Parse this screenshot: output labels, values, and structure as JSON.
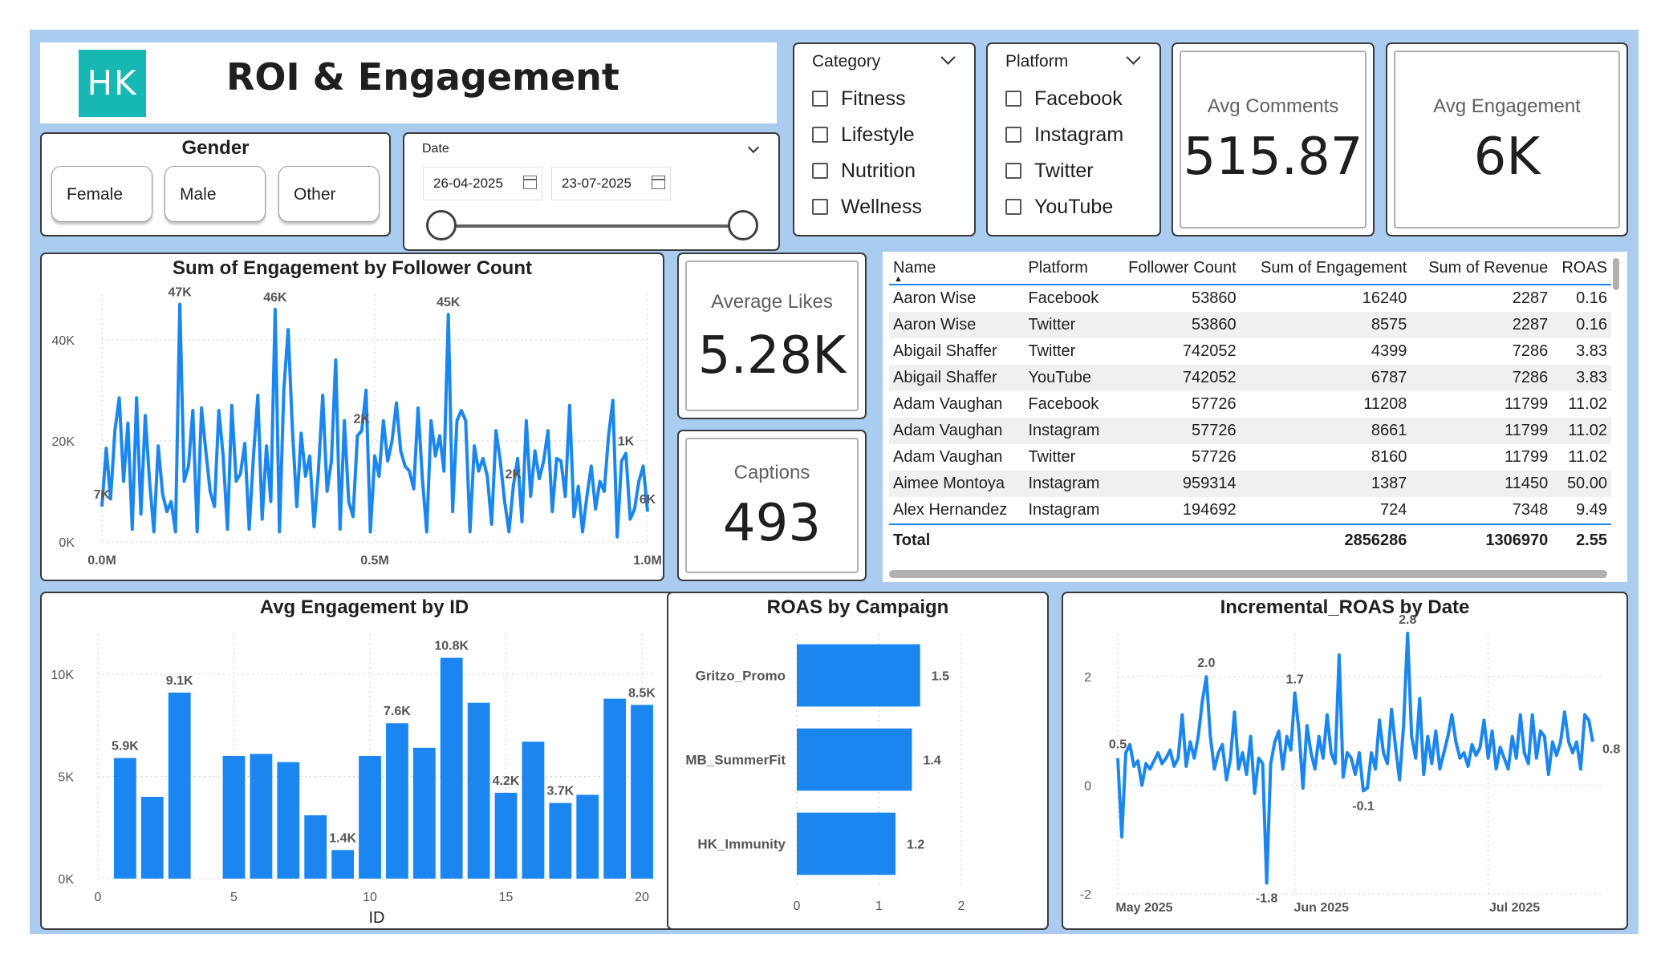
{
  "header": {
    "logo_text": "HK",
    "title": "ROI & Engagement"
  },
  "gender": {
    "title": "Gender",
    "buttons": [
      "Female",
      "Male",
      "Other"
    ]
  },
  "date_filter": {
    "label": "Date",
    "start": "26-04-2025",
    "end": "23-07-2025"
  },
  "category_filter": {
    "label": "Category",
    "options": [
      "Fitness",
      "Lifestyle",
      "Nutrition",
      "Wellness"
    ]
  },
  "platform_filter": {
    "label": "Platform",
    "options": [
      "Facebook",
      "Instagram",
      "Twitter",
      "YouTube"
    ]
  },
  "kpis": {
    "avg_comments": {
      "label": "Avg Comments",
      "value": "515.87"
    },
    "avg_engagement": {
      "label": "Avg Engagement",
      "value": "6K"
    },
    "average_likes": {
      "label": "Average Likes",
      "value": "5.28K"
    },
    "captions": {
      "label": "Captions",
      "value": "493"
    }
  },
  "table": {
    "columns": [
      "Name",
      "Platform",
      "Follower Count",
      "Sum of Engagement",
      "Sum of Revenue",
      "ROAS"
    ],
    "rows": [
      [
        "Aaron Wise",
        "Facebook",
        "53860",
        "16240",
        "2287",
        "0.16"
      ],
      [
        "Aaron Wise",
        "Twitter",
        "53860",
        "8575",
        "2287",
        "0.16"
      ],
      [
        "Abigail Shaffer",
        "Twitter",
        "742052",
        "4399",
        "7286",
        "3.83"
      ],
      [
        "Abigail Shaffer",
        "YouTube",
        "742052",
        "6787",
        "7286",
        "3.83"
      ],
      [
        "Adam Vaughan",
        "Facebook",
        "57726",
        "11208",
        "11799",
        "11.02"
      ],
      [
        "Adam Vaughan",
        "Instagram",
        "57726",
        "8661",
        "11799",
        "11.02"
      ],
      [
        "Adam Vaughan",
        "Twitter",
        "57726",
        "8160",
        "11799",
        "11.02"
      ],
      [
        "Aimee Montoya",
        "Instagram",
        "959314",
        "1387",
        "11450",
        "50.00"
      ],
      [
        "Alex Hernandez",
        "Instagram",
        "194692",
        "724",
        "7348",
        "9.49"
      ]
    ],
    "total": {
      "label": "Total",
      "sum_engagement": "2856286",
      "sum_revenue": "1306970",
      "roas": "2.55"
    }
  },
  "chart_data": [
    {
      "id": "engagement_by_follower",
      "type": "line",
      "title": "Sum of Engagement by Follower Count",
      "x_ticks": [
        "0.0M",
        "0.5M",
        "1.0M"
      ],
      "y_ticks": [
        "0K",
        "20K",
        "40K"
      ],
      "xlim": [
        0,
        1000000
      ],
      "ylim": [
        0,
        49000
      ],
      "color": "#1b86f0",
      "y": [
        7000,
        18500,
        8500,
        22000,
        28500,
        12000,
        23500,
        2500,
        28500,
        5500,
        25000,
        12000,
        2000,
        19000,
        9500,
        6000,
        8000,
        2000,
        47000,
        12000,
        15000,
        26000,
        2000,
        26500,
        18000,
        10000,
        7000,
        26000,
        17000,
        2500,
        27000,
        12000,
        13500,
        19500,
        2500,
        17000,
        29000,
        4500,
        19000,
        8000,
        46000,
        2000,
        30000,
        42000,
        22000,
        7000,
        21500,
        13000,
        17000,
        3000,
        14000,
        29000,
        10000,
        16000,
        36000,
        2500,
        24000,
        8000,
        5000,
        21000,
        22000,
        30000,
        2000,
        17000,
        13000,
        24000,
        16000,
        20000,
        27500,
        18000,
        15000,
        14000,
        10500,
        26500,
        12500,
        2000,
        24000,
        17000,
        21000,
        14000,
        45000,
        6000,
        24000,
        26000,
        24000,
        2000,
        19000,
        14000,
        16500,
        13000,
        3500,
        22000,
        16000,
        8000,
        2000,
        11000,
        16500,
        4000,
        24000,
        9000,
        18000,
        12500,
        16000,
        22000,
        6000,
        16500,
        16000,
        9000,
        27000,
        5000,
        11000,
        2000,
        9000,
        15000,
        6500,
        12000,
        10000,
        21000,
        28000,
        1000,
        16000,
        17500,
        4500,
        6500,
        12000,
        15000,
        6000
      ],
      "labels": [
        {
          "i": 0,
          "text": "7K"
        },
        {
          "i": 18,
          "text": "47K"
        },
        {
          "i": 40,
          "text": "46K"
        },
        {
          "i": 60,
          "text": "2K"
        },
        {
          "i": 80,
          "text": "45K"
        },
        {
          "i": 95,
          "text": "2K"
        },
        {
          "i": 121,
          "text": "1K"
        },
        {
          "i": 126,
          "text": "6K"
        }
      ]
    },
    {
      "id": "avg_engagement_by_id",
      "type": "bar",
      "title": "Avg Engagement by ID",
      "xlabel": "ID",
      "x_ticks": [
        "0",
        "5",
        "10",
        "15",
        "20"
      ],
      "y_ticks": [
        "0K",
        "5K",
        "10K"
      ],
      "xlim": [
        0,
        20.5
      ],
      "ylim": [
        0,
        12000
      ],
      "color": "#1b86f0",
      "categories": [
        1,
        2,
        3,
        4,
        5,
        6,
        7,
        8,
        9,
        10,
        11,
        12,
        13,
        14,
        15,
        16,
        17,
        18,
        19,
        20
      ],
      "values": [
        5900,
        4000,
        9100,
        6000,
        6100,
        5700,
        3100,
        1400,
        6000,
        7600,
        6400,
        10800,
        8600,
        4200,
        6700,
        3700,
        4100,
        8800,
        8500
      ],
      "ids": [
        1,
        2,
        3,
        5,
        6,
        7,
        8,
        9,
        10,
        11,
        12,
        13,
        14,
        15,
        16,
        17,
        18,
        19,
        20
      ],
      "labels": [
        {
          "id": 1,
          "text": "5.9K"
        },
        {
          "id": 3,
          "text": "9.1K"
        },
        {
          "id": 9,
          "text": "1.4K"
        },
        {
          "id": 11,
          "text": "7.6K"
        },
        {
          "id": 13,
          "text": "10.8K"
        },
        {
          "id": 15,
          "text": "4.2K"
        },
        {
          "id": 17,
          "text": "3.7K"
        },
        {
          "id": 20,
          "text": "8.5K"
        }
      ]
    },
    {
      "id": "roas_by_campaign",
      "type": "bar",
      "orientation": "horizontal",
      "title": "ROAS by Campaign",
      "categories": [
        "Gritzo_Promo",
        "MB_SummerFit",
        "HK_Immunity"
      ],
      "values": [
        1.5,
        1.4,
        1.2
      ],
      "value_labels": [
        "1.5",
        "1.4",
        "1.2"
      ],
      "x_ticks": [
        "0",
        "1",
        "2"
      ],
      "xlim": [
        0,
        2
      ],
      "color": "#1b86f0"
    },
    {
      "id": "incremental_roas_by_date",
      "type": "line",
      "title": "Incremental_ROAS by Date",
      "x_ticks": [
        "May 2025",
        "Jun 2025",
        "Jul 2025"
      ],
      "y_ticks": [
        "-2",
        "0",
        "2"
      ],
      "ylim": [
        -2,
        2.8
      ],
      "color": "#1b86f0",
      "y": [
        0.5,
        -0.95,
        0.6,
        0.75,
        0.35,
        0.45,
        0.0,
        0.4,
        0.3,
        0.45,
        0.6,
        0.4,
        0.5,
        0.65,
        0.35,
        0.5,
        1.3,
        0.35,
        0.8,
        0.5,
        0.9,
        1.55,
        2.0,
        0.9,
        0.3,
        0.6,
        0.75,
        0.1,
        0.5,
        1.35,
        0.3,
        0.6,
        0.2,
        0.9,
        -0.15,
        0.5,
        0.4,
        -1.8,
        0.4,
        0.8,
        1.0,
        0.3,
        0.9,
        0.65,
        1.7,
        1.0,
        -0.05,
        1.1,
        0.6,
        0.3,
        0.9,
        0.5,
        1.3,
        0.6,
        0.4,
        2.4,
        0.15,
        0.6,
        0.5,
        0.2,
        0.6,
        -0.1,
        -0.05,
        0.6,
        0.3,
        1.2,
        0.6,
        0.4,
        1.4,
        0.7,
        0.1,
        1.1,
        2.8,
        0.9,
        0.5,
        1.6,
        0.2,
        0.9,
        0.4,
        1.0,
        0.3,
        0.6,
        0.9,
        1.3,
        0.8,
        0.5,
        0.6,
        0.35,
        0.75,
        0.55,
        0.7,
        1.2,
        0.5,
        1.0,
        0.3,
        0.7,
        0.5,
        0.3,
        0.9,
        0.5,
        1.3,
        0.6,
        0.4,
        1.3,
        0.5,
        1.0,
        0.9,
        0.2,
        0.8,
        0.55,
        0.8,
        1.35,
        0.8,
        0.6,
        0.8,
        0.3,
        1.3,
        1.2,
        0.8
      ],
      "labels": [
        {
          "i": 0,
          "text": "0.5"
        },
        {
          "i": 22,
          "text": "2.0"
        },
        {
          "i": 37,
          "text": "-1.8"
        },
        {
          "i": 44,
          "text": "1.7"
        },
        {
          "i": 61,
          "text": "-0.1"
        },
        {
          "i": 72,
          "text": "2.8"
        },
        {
          "i": 118,
          "text": "0.8"
        }
      ]
    }
  ]
}
